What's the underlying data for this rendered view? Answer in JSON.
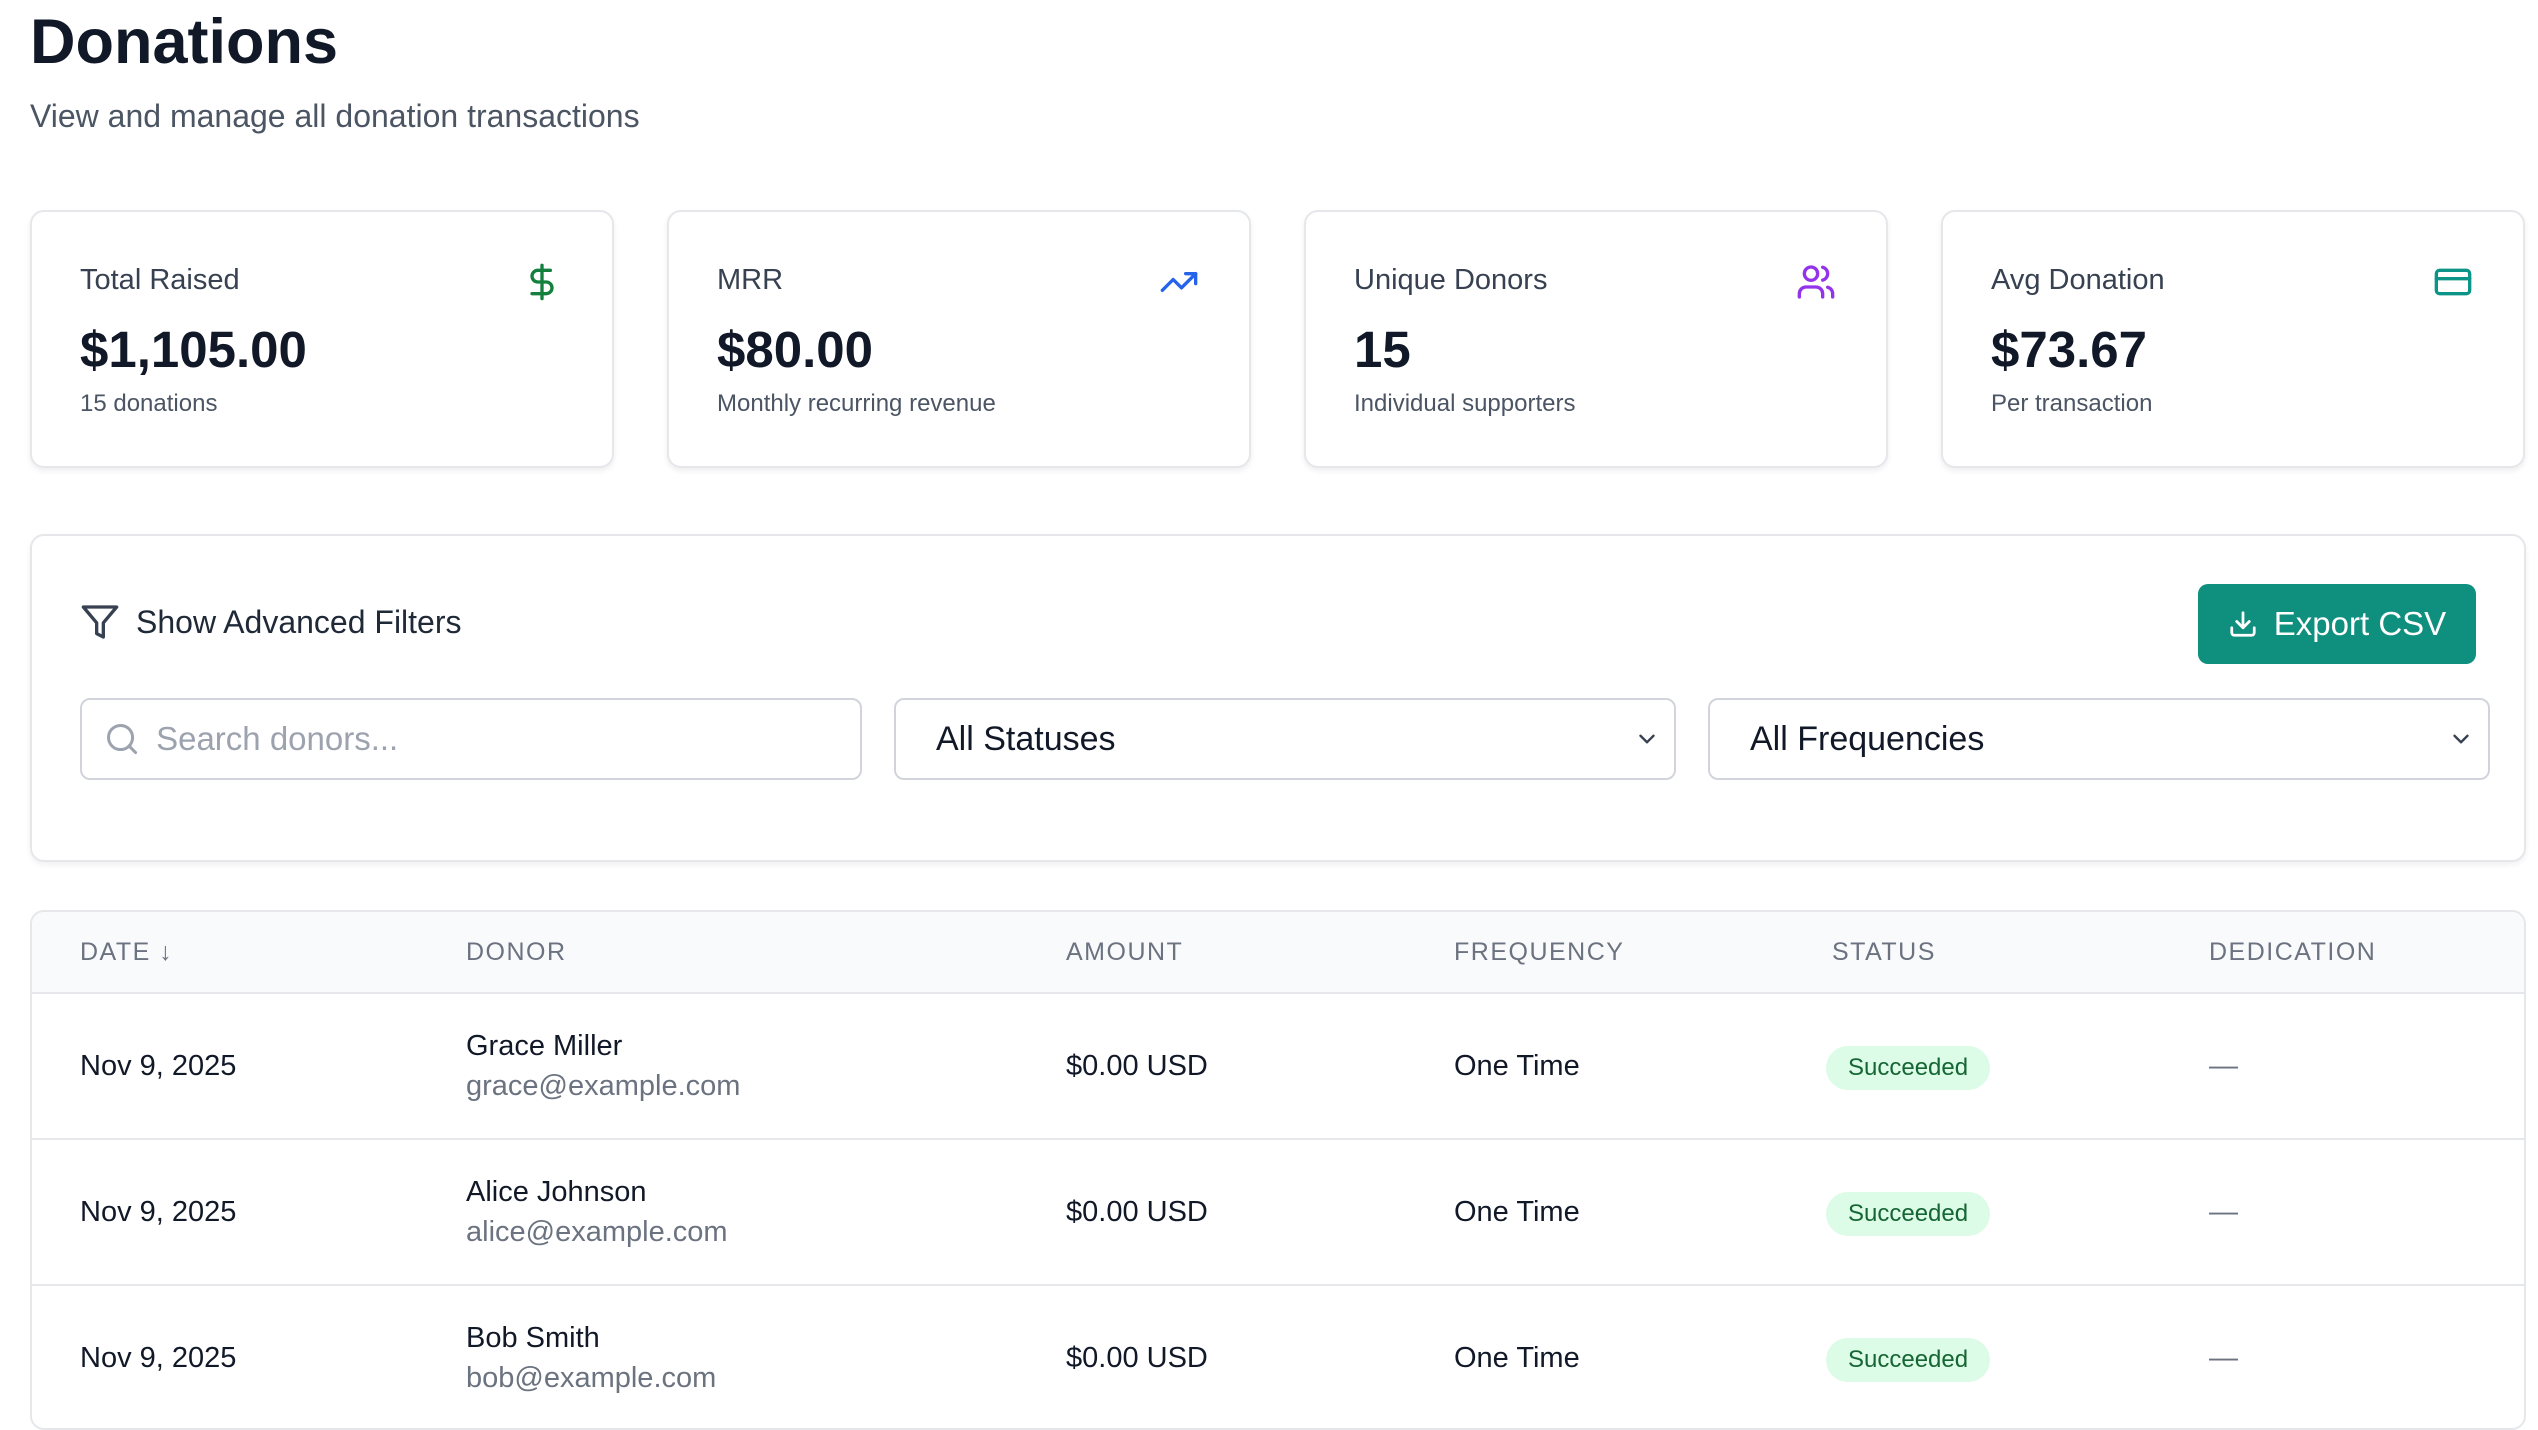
{
  "header": {
    "title": "Donations",
    "subtitle": "View and manage all donation transactions"
  },
  "stats": [
    {
      "label": "Total Raised",
      "value": "$1,105.00",
      "note": "15 donations",
      "icon": "dollar-icon",
      "color": "#15803d"
    },
    {
      "label": "MRR",
      "value": "$80.00",
      "note": "Monthly recurring revenue",
      "icon": "trending-up-icon",
      "color": "#2563eb"
    },
    {
      "label": "Unique Donors",
      "value": "15",
      "note": "Individual supporters",
      "icon": "users-icon",
      "color": "#9333ea"
    },
    {
      "label": "Avg Donation",
      "value": "$73.67",
      "note": "Per transaction",
      "icon": "credit-card-icon",
      "color": "#0d9488"
    }
  ],
  "filters": {
    "advanced_label": "Show Advanced Filters",
    "export_label": "Export CSV",
    "search_placeholder": "Search donors...",
    "status_value": "All Statuses",
    "frequency_value": "All Frequencies"
  },
  "table": {
    "columns": [
      "DATE ↓",
      "DONOR",
      "AMOUNT",
      "FREQUENCY",
      "STATUS",
      "DEDICATION"
    ],
    "rows": [
      {
        "date": "Nov 9, 2025",
        "name": "Grace Miller",
        "email": "grace@example.com",
        "amount": "$0.00 USD",
        "frequency": "One Time",
        "status": "Succeeded",
        "dedication": "—"
      },
      {
        "date": "Nov 9, 2025",
        "name": "Alice Johnson",
        "email": "alice@example.com",
        "amount": "$0.00 USD",
        "frequency": "One Time",
        "status": "Succeeded",
        "dedication": "—"
      },
      {
        "date": "Nov 9, 2025",
        "name": "Bob Smith",
        "email": "bob@example.com",
        "amount": "$0.00 USD",
        "frequency": "One Time",
        "status": "Succeeded",
        "dedication": "—"
      }
    ]
  },
  "colors": {
    "accent": "#0f8f7d",
    "badge_bg": "#dcfce7",
    "badge_text": "#166534"
  }
}
